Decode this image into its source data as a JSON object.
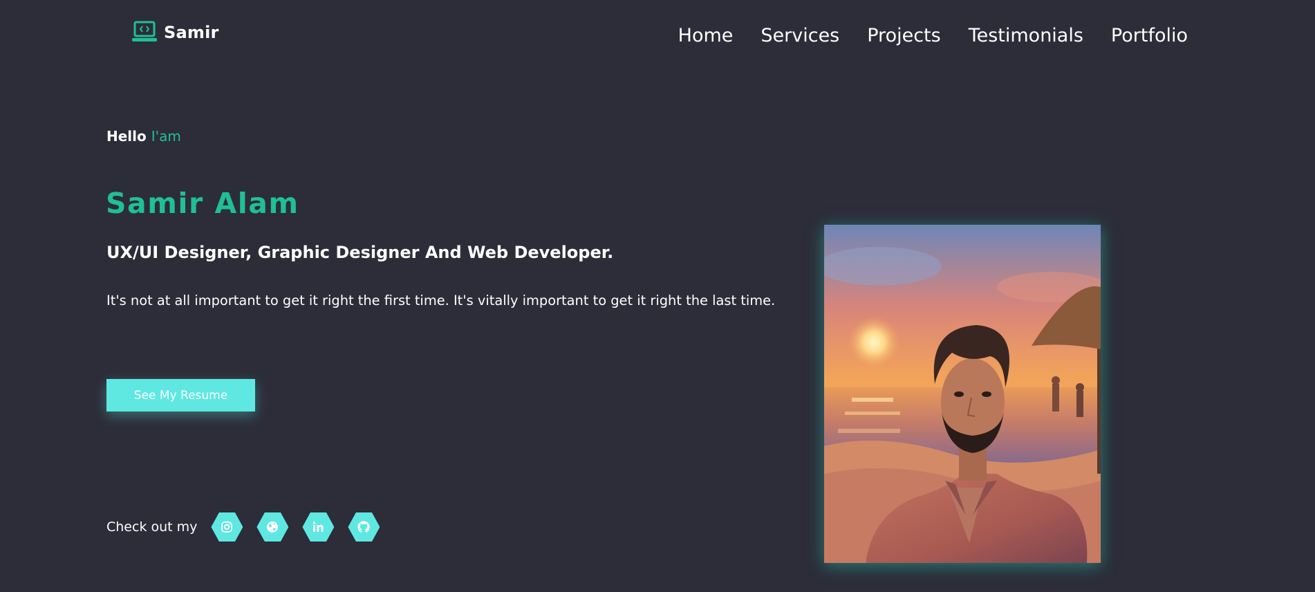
{
  "brand": {
    "name": "Samir",
    "icon": "laptop-code-icon"
  },
  "nav": {
    "items": [
      {
        "label": "Home"
      },
      {
        "label": "Services"
      },
      {
        "label": "Projects"
      },
      {
        "label": "Testimonials"
      },
      {
        "label": "Portfolio"
      }
    ]
  },
  "hero": {
    "greeting": "Hello",
    "greeting_accent": "I'am",
    "name": "Samir Alam",
    "role": "UX/UI Designer, Graphic Designer And Web Developer.",
    "quote": "It's not at all important to get it right the first time. It's vitally important to get it right the last time.",
    "cta_label": "See My Resume"
  },
  "social": {
    "label": "Check out my",
    "links": [
      {
        "icon": "instagram-icon"
      },
      {
        "icon": "globe-icon"
      },
      {
        "icon": "linkedin-icon"
      },
      {
        "icon": "github-icon"
      }
    ]
  },
  "colors": {
    "background": "#2c2d39",
    "accent": "#1fbf97",
    "button": "#5ee8e1",
    "text": "#ffffff"
  }
}
